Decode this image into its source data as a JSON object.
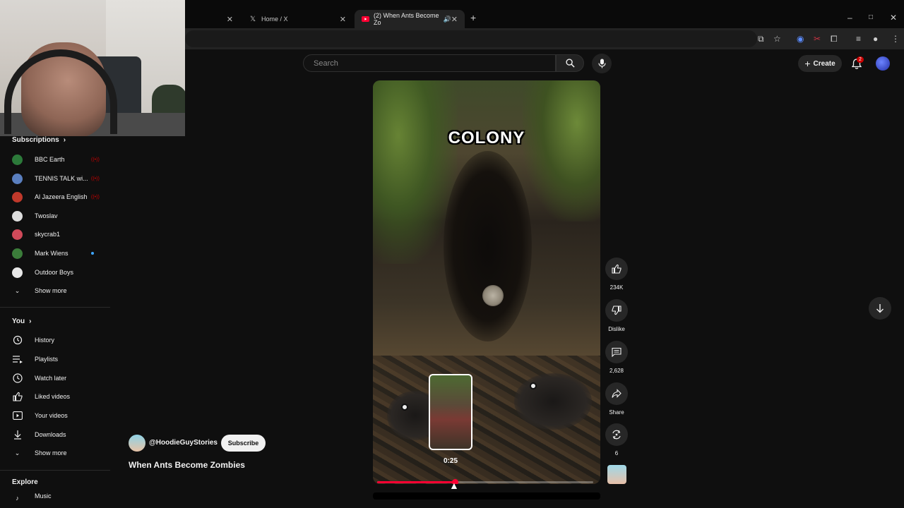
{
  "browser": {
    "tabs": [
      {
        "label": "Home / X",
        "icon": "x-logo-icon"
      },
      {
        "label": "(2) When Ants Become Zo",
        "icon": "youtube-icon",
        "active": true
      }
    ],
    "window_controls": {
      "minimize": "–",
      "maximize": "□",
      "close": "✕"
    }
  },
  "header": {
    "search_placeholder": "Search",
    "create_label": "Create",
    "notification_count": "2"
  },
  "sidebar": {
    "subscriptions_title": "Subscriptions",
    "channels": [
      {
        "name": "BBC Earth",
        "status": "live",
        "color": "#2c7a3a"
      },
      {
        "name": "TENNIS TALK wi...",
        "status": "live",
        "color": "#5a7fbf"
      },
      {
        "name": "Al Jazeera English",
        "status": "live",
        "color": "#c0392b"
      },
      {
        "name": "Twoslav",
        "status": "",
        "color": "#dddddd"
      },
      {
        "name": "skycrab1",
        "status": "",
        "color": "#d04a5a"
      },
      {
        "name": "Mark Wiens",
        "status": "new",
        "color": "#3b7d3a"
      },
      {
        "name": "Outdoor Boys",
        "status": "",
        "color": "#e8e8e8"
      }
    ],
    "show_more_1": "Show more",
    "you_title": "You",
    "you_items": [
      {
        "label": "History",
        "icon": "history-icon"
      },
      {
        "label": "Playlists",
        "icon": "playlists-icon"
      },
      {
        "label": "Watch later",
        "icon": "clock-icon"
      },
      {
        "label": "Liked videos",
        "icon": "thumbs-up-icon"
      },
      {
        "label": "Your videos",
        "icon": "play-square-icon"
      },
      {
        "label": "Downloads",
        "icon": "download-icon"
      }
    ],
    "show_more_2": "Show more",
    "explore_title": "Explore",
    "explore_partial": "Music"
  },
  "short": {
    "caption": "COLONY",
    "preview_time": "0:25",
    "progress": 0.36,
    "actions": {
      "likes": "234K",
      "dislike": "Dislike",
      "comments": "2,628",
      "share": "Share",
      "remix": "6"
    },
    "channel_handle": "@HoodieGuyStories",
    "subscribe_label": "Subscribe",
    "title": "When Ants Become Zombies"
  }
}
